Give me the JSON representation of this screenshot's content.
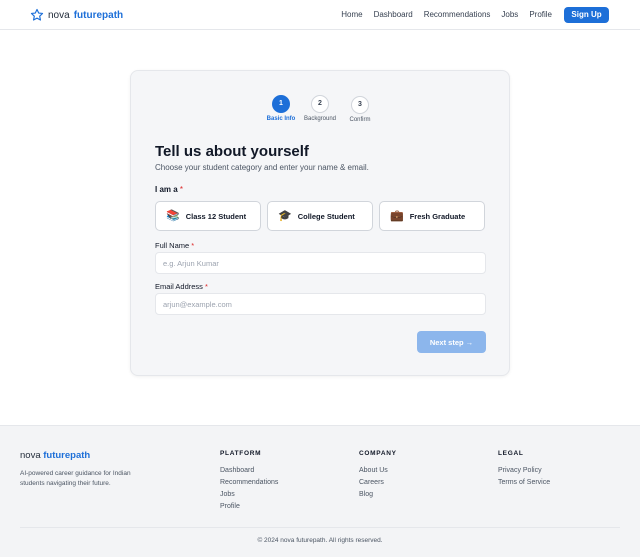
{
  "header": {
    "brand_prefix": "nova",
    "brand_accent": "futurepath",
    "logo_icon": "star-outline-icon",
    "nav": [
      "Home",
      "Dashboard",
      "Recommendations",
      "Jobs",
      "Profile"
    ],
    "signup_label": "Sign Up"
  },
  "stepper": {
    "steps": [
      {
        "number": "1",
        "label": "Basic Info",
        "active": true
      },
      {
        "number": "2",
        "label": "Background",
        "active": false
      },
      {
        "number": "3",
        "label": "Confirm",
        "active": false
      }
    ]
  },
  "form": {
    "title": "Tell us about yourself",
    "subtitle": "Choose your student category and enter your name & email.",
    "category_label": "I am a",
    "required_mark": "*",
    "options": [
      {
        "icon": "📚",
        "icon_name": "books-icon",
        "label": "Class 12 Student"
      },
      {
        "icon": "🎓",
        "icon_name": "graduation-cap-icon",
        "label": "College Student"
      },
      {
        "icon": "💼",
        "icon_name": "briefcase-icon",
        "label": "Fresh Graduate"
      }
    ],
    "name_label": "Full Name",
    "name_placeholder": "e.g. Arjun Kumar",
    "name_value": "",
    "email_label": "Email Address",
    "email_placeholder": "arjun@example.com",
    "email_value": "",
    "next_label": "Next step →"
  },
  "footer": {
    "brand_prefix": "nova",
    "brand_accent": "futurepath",
    "tagline": "AI-powered career guidance for Indian students navigating their future.",
    "columns": [
      {
        "heading": "PLATFORM",
        "links": [
          "Dashboard",
          "Recommendations",
          "Jobs",
          "Profile"
        ]
      },
      {
        "heading": "COMPANY",
        "links": [
          "About Us",
          "Careers",
          "Blog"
        ]
      },
      {
        "heading": "LEGAL",
        "links": [
          "Privacy Policy",
          "Terms of Service"
        ]
      }
    ],
    "copyright": "© 2024 nova futurepath. All rights reserved."
  },
  "colors": {
    "accent": "#1d6fd8",
    "next_button_disabled": "#8cb6ec",
    "required": "#dc2626"
  }
}
